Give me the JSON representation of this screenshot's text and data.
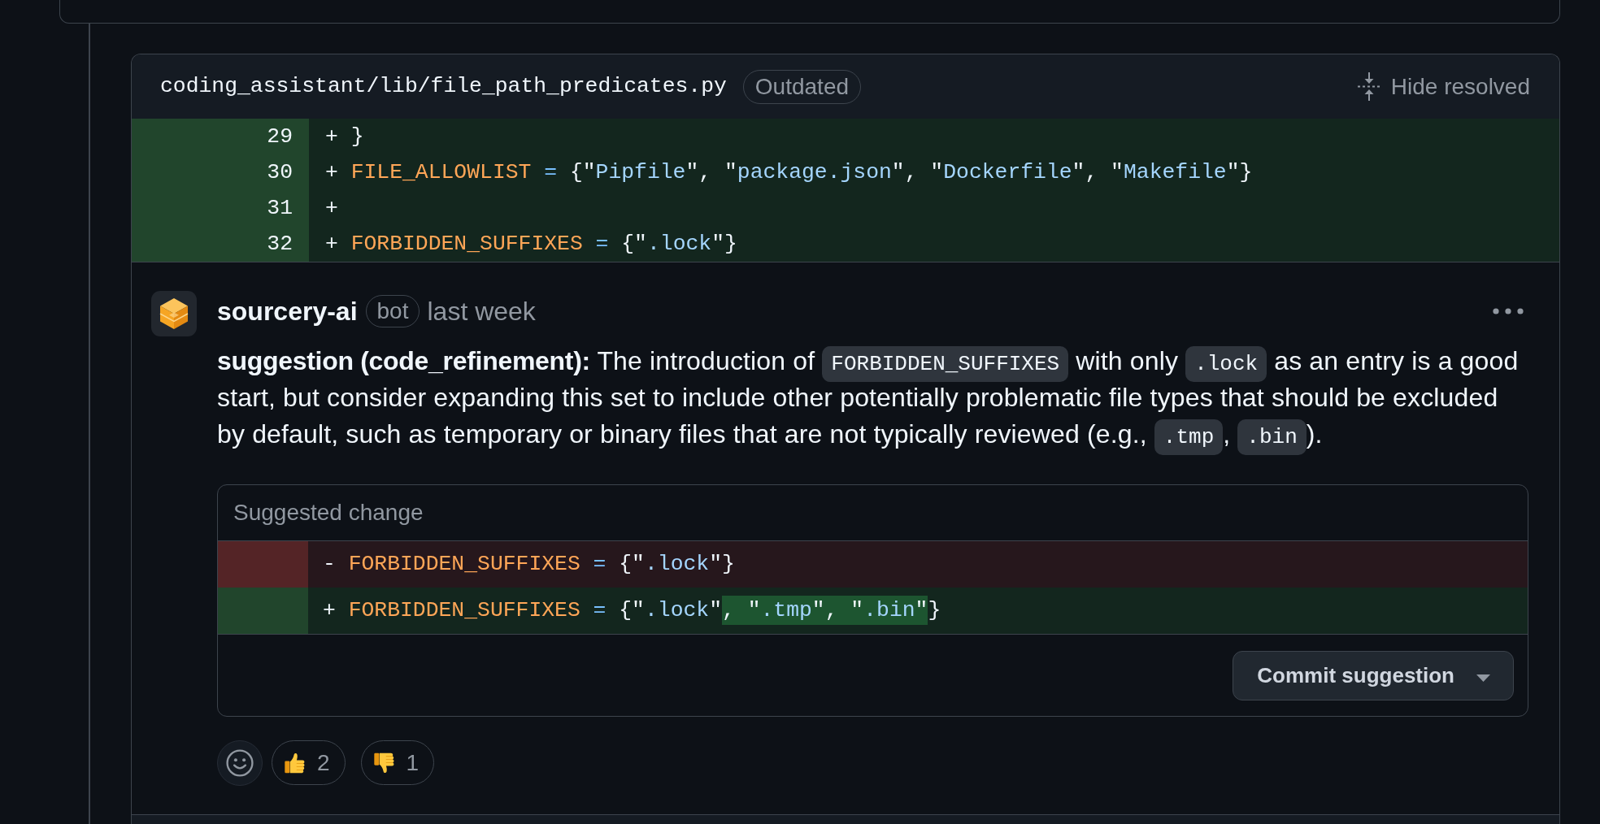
{
  "file": {
    "path": "coding_assistant/lib/file_path_predicates.py",
    "status": "Outdated",
    "action": "Hide resolved"
  },
  "diff": [
    {
      "number": "29",
      "kind": "addition",
      "sign": "+",
      "tokens": [
        {
          "text": "}",
          "kind": "plain"
        }
      ]
    },
    {
      "number": "30",
      "kind": "addition",
      "sign": "+",
      "tokens": [
        {
          "text": "FILE_ALLOWLIST",
          "kind": "constant"
        },
        {
          "text": " = ",
          "kind": "operator"
        },
        {
          "text": "{\"",
          "kind": "plain"
        },
        {
          "text": "Pipfile",
          "kind": "string"
        },
        {
          "text": "\", \"",
          "kind": "plain"
        },
        {
          "text": "package.json",
          "kind": "string"
        },
        {
          "text": "\", \"",
          "kind": "plain"
        },
        {
          "text": "Dockerfile",
          "kind": "string"
        },
        {
          "text": "\", \"",
          "kind": "plain"
        },
        {
          "text": "Makefile",
          "kind": "string"
        },
        {
          "text": "\"}",
          "kind": "plain"
        }
      ]
    },
    {
      "number": "31",
      "kind": "addition",
      "sign": "+"
    },
    {
      "number": "32",
      "kind": "addition",
      "sign": "+",
      "tokens": [
        {
          "text": "FORBIDDEN_SUFFIXES",
          "kind": "constant"
        },
        {
          "text": " = ",
          "kind": "operator"
        },
        {
          "text": "{\"",
          "kind": "plain"
        },
        {
          "text": ".lock",
          "kind": "string"
        },
        {
          "text": "\"}",
          "kind": "plain"
        }
      ]
    }
  ],
  "comment": {
    "author": "sourcery-ai",
    "badge": "bot",
    "time": "last week",
    "body": [
      {
        "kind": "text",
        "text": "**suggestion (code_refinement):** The introduction of "
      },
      {
        "kind": "code",
        "text": "FORBIDDEN_SUFFIXES"
      },
      {
        "kind": "text",
        "text": " with only "
      },
      {
        "kind": "code",
        "text": ".lock"
      },
      {
        "kind": "text",
        "text": " as an entry is a good start, but consider expanding this set to include other potentially problematic file types that should be excluded by default, such as temporary or binary files that are not typically reviewed (e.g., "
      },
      {
        "kind": "code",
        "text": ".tmp"
      },
      {
        "kind": "text",
        "text": ", "
      },
      {
        "kind": "code",
        "text": ".bin"
      },
      {
        "kind": "text",
        "text": ")."
      }
    ],
    "suggestion": {
      "title": "Suggested change",
      "lines": [
        {
          "kind": "deletion",
          "sign": "-",
          "tokens": [
            {
              "text": "FORBIDDEN_SUFFIXES",
              "kind": "constant",
              "highlight": false
            },
            {
              "text": " = ",
              "kind": "operator",
              "highlight": false
            },
            {
              "text": "{\"",
              "kind": "plain",
              "highlight": false
            },
            {
              "text": ".lock",
              "kind": "string",
              "highlight": false
            },
            {
              "text": "\"}",
              "kind": "plain",
              "highlight": false
            }
          ]
        },
        {
          "kind": "addition",
          "sign": "+",
          "tokens": [
            {
              "text": "FORBIDDEN_SUFFIXES",
              "kind": "constant",
              "highlight": false
            },
            {
              "text": " = ",
              "kind": "operator",
              "highlight": false
            },
            {
              "text": "{\"",
              "kind": "plain",
              "highlight": false
            },
            {
              "text": ".lock",
              "kind": "string",
              "highlight": false
            },
            {
              "text": "\"",
              "kind": "plain",
              "highlight": false
            },
            {
              "text": ", \"",
              "kind": "plain",
              "highlight": true
            },
            {
              "text": ".tmp",
              "kind": "string",
              "highlight": true
            },
            {
              "text": "\", \"",
              "kind": "plain",
              "highlight": true
            },
            {
              "text": ".bin",
              "kind": "string",
              "highlight": true
            },
            {
              "text": "\"",
              "kind": "plain",
              "highlight": true
            },
            {
              "text": "}",
              "kind": "plain",
              "highlight": false
            }
          ]
        }
      ],
      "button": "Commit suggestion"
    }
  },
  "reactions": [
    {
      "kind": "thumbs_up",
      "count": "2"
    },
    {
      "kind": "thumbs_down",
      "count": "1"
    }
  ]
}
